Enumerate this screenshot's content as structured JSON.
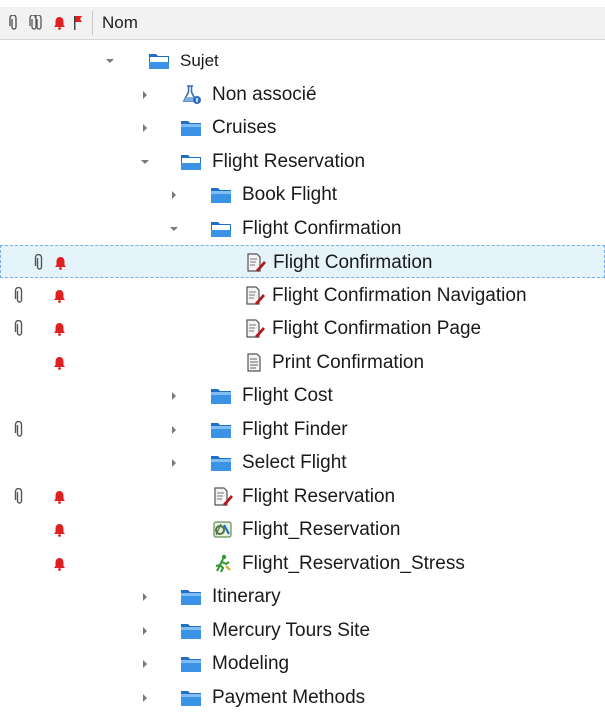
{
  "header": {
    "name_column": "Nom"
  },
  "colors": {
    "folder": "#2f86d8",
    "bell": "#e02020",
    "selection": "#e5f3fb"
  },
  "tree": [
    {
      "label": "Sujet",
      "icon": "folder-open-icon",
      "expander": "expanded",
      "attach": false,
      "alert": false
    },
    {
      "label": "Non associé",
      "icon": "flask-icon",
      "expander": "collapsed",
      "attach": false,
      "alert": false
    },
    {
      "label": "Cruises",
      "icon": "folder-icon",
      "expander": "collapsed",
      "attach": false,
      "alert": false
    },
    {
      "label": "Flight Reservation",
      "icon": "folder-open-icon",
      "expander": "expanded",
      "attach": false,
      "alert": false
    },
    {
      "label": "Book Flight",
      "icon": "folder-icon",
      "expander": "collapsed",
      "attach": false,
      "alert": false
    },
    {
      "label": "Flight Confirmation",
      "icon": "folder-open-icon",
      "expander": "expanded",
      "attach": false,
      "alert": false
    },
    {
      "label": "Flight Confirmation",
      "icon": "manual-test-icon",
      "expander": "none",
      "attach": true,
      "alert": true,
      "selected": true
    },
    {
      "label": "Flight Confirmation Navigation",
      "icon": "manual-test-icon",
      "expander": "none",
      "attach": true,
      "alert": true
    },
    {
      "label": "Flight Confirmation Page",
      "icon": "manual-test-icon",
      "expander": "none",
      "attach": true,
      "alert": true
    },
    {
      "label": "Print Confirmation",
      "icon": "document-icon",
      "expander": "none",
      "attach": false,
      "alert": true
    },
    {
      "label": "Flight Cost",
      "icon": "folder-icon",
      "expander": "collapsed",
      "attach": false,
      "alert": false
    },
    {
      "label": "Flight Finder",
      "icon": "folder-icon",
      "expander": "collapsed",
      "attach": true,
      "alert": false
    },
    {
      "label": "Select Flight",
      "icon": "folder-icon",
      "expander": "collapsed",
      "attach": false,
      "alert": false
    },
    {
      "label": "Flight Reservation",
      "icon": "manual-test-icon",
      "expander": "none",
      "attach": true,
      "alert": true
    },
    {
      "label": "Flight_Reservation",
      "icon": "automated-test-icon",
      "expander": "none",
      "attach": false,
      "alert": true
    },
    {
      "label": "Flight_Reservation_Stress",
      "icon": "performance-test-icon",
      "expander": "none",
      "attach": false,
      "alert": true
    },
    {
      "label": "Itinerary",
      "icon": "folder-icon",
      "expander": "collapsed",
      "attach": false,
      "alert": false
    },
    {
      "label": "Mercury Tours Site",
      "icon": "folder-icon",
      "expander": "collapsed",
      "attach": false,
      "alert": false
    },
    {
      "label": "Modeling",
      "icon": "folder-icon",
      "expander": "collapsed",
      "attach": false,
      "alert": false
    },
    {
      "label": "Payment Methods",
      "icon": "folder-icon",
      "expander": "collapsed",
      "attach": false,
      "alert": false
    }
  ]
}
